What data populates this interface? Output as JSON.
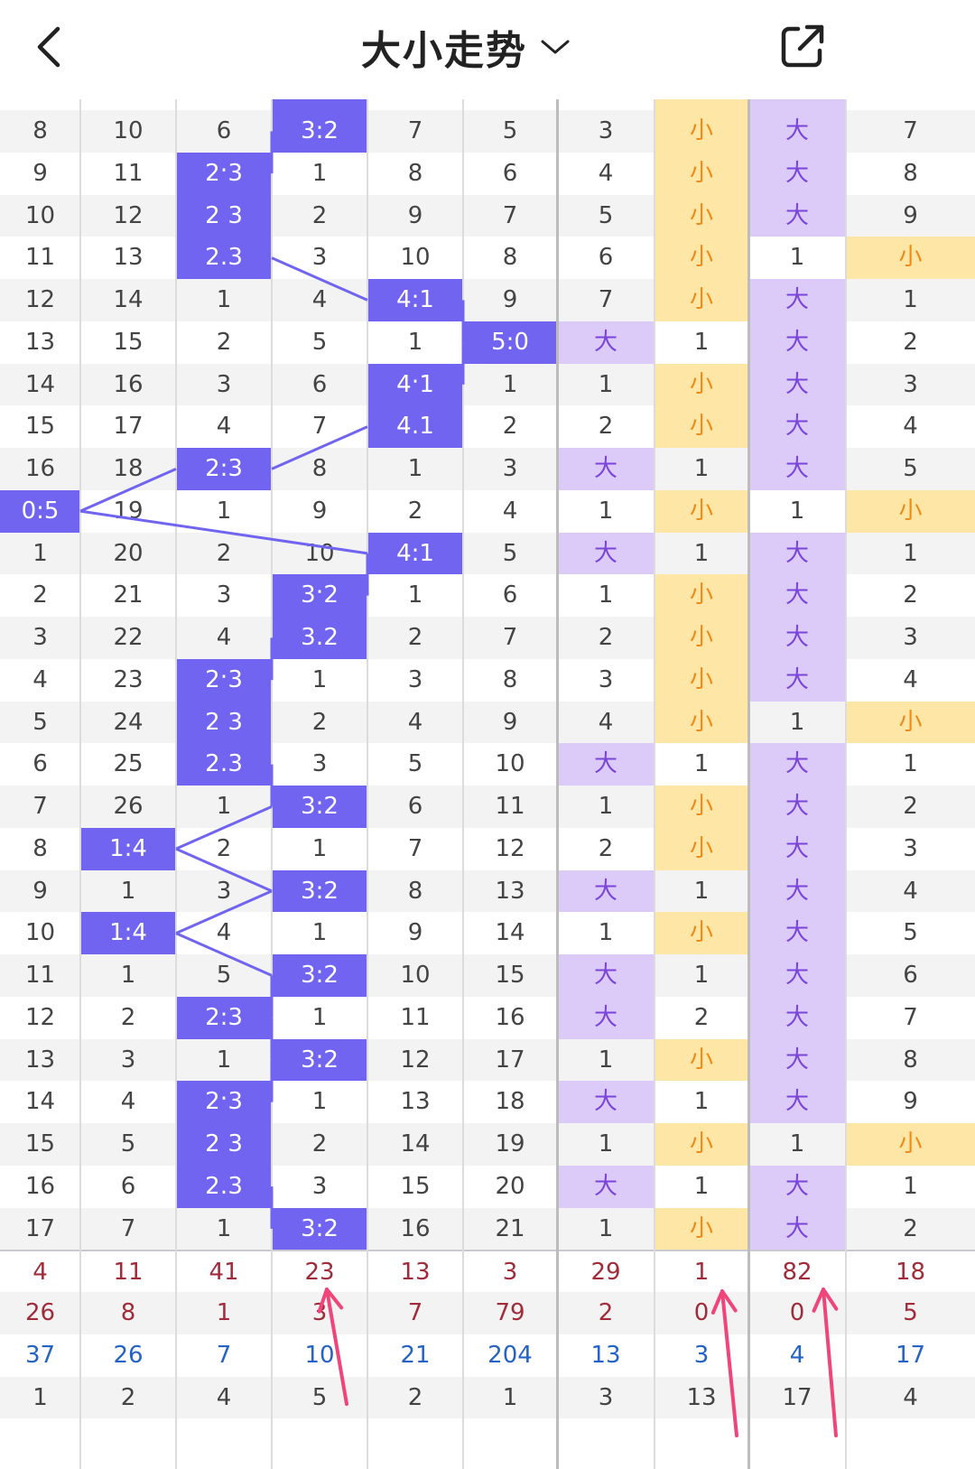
{
  "header": {
    "title": "大小走势",
    "back_icon": "chevron-left-icon",
    "dropdown_icon": "chevron-down-icon",
    "share_icon": "share-external-icon"
  },
  "colors": {
    "highlight": "#7064f0",
    "big_bg": "#dccaf9",
    "big_text": "#7a45d8",
    "small_bg": "#fde6a6",
    "small_text": "#ee8a16",
    "stat_red": "#a02c3a",
    "stat_blue": "#2563c4",
    "annotation_arrow": "#f0457a"
  },
  "rows": [
    {
      "cells": [
        "8",
        "10",
        "6",
        "3:2",
        "7",
        "5",
        "3",
        "小",
        "大",
        "7"
      ]
    },
    {
      "cells": [
        "9",
        "11",
        "2:3",
        "1",
        "8",
        "6",
        "4",
        "小",
        "大",
        "8"
      ]
    },
    {
      "cells": [
        "10",
        "12",
        "2:3",
        "2",
        "9",
        "7",
        "5",
        "小",
        "大",
        "9"
      ]
    },
    {
      "cells": [
        "11",
        "13",
        "2:3",
        "3",
        "10",
        "8",
        "6",
        "小",
        "1",
        "小"
      ]
    },
    {
      "cells": [
        "12",
        "14",
        "1",
        "4",
        "4:1",
        "9",
        "7",
        "小",
        "大",
        "1"
      ]
    },
    {
      "cells": [
        "13",
        "15",
        "2",
        "5",
        "1",
        "5:0",
        "大",
        "1",
        "大",
        "2"
      ]
    },
    {
      "cells": [
        "14",
        "16",
        "3",
        "6",
        "4:1",
        "1",
        "1",
        "小",
        "大",
        "3"
      ]
    },
    {
      "cells": [
        "15",
        "17",
        "4",
        "7",
        "4:1",
        "2",
        "2",
        "小",
        "大",
        "4"
      ]
    },
    {
      "cells": [
        "16",
        "18",
        "2:3",
        "8",
        "1",
        "3",
        "大",
        "1",
        "大",
        "5"
      ]
    },
    {
      "cells": [
        "0:5",
        "19",
        "1",
        "9",
        "2",
        "4",
        "1",
        "小",
        "1",
        "小"
      ]
    },
    {
      "cells": [
        "1",
        "20",
        "2",
        "10",
        "4:1",
        "5",
        "大",
        "1",
        "大",
        "1"
      ]
    },
    {
      "cells": [
        "2",
        "21",
        "3",
        "3:2",
        "1",
        "6",
        "1",
        "小",
        "大",
        "2"
      ]
    },
    {
      "cells": [
        "3",
        "22",
        "4",
        "3:2",
        "2",
        "7",
        "2",
        "小",
        "大",
        "3"
      ]
    },
    {
      "cells": [
        "4",
        "23",
        "2:3",
        "1",
        "3",
        "8",
        "3",
        "小",
        "大",
        "4"
      ]
    },
    {
      "cells": [
        "5",
        "24",
        "2:3",
        "2",
        "4",
        "9",
        "4",
        "小",
        "1",
        "小"
      ]
    },
    {
      "cells": [
        "6",
        "25",
        "2:3",
        "3",
        "5",
        "10",
        "大",
        "1",
        "大",
        "1"
      ]
    },
    {
      "cells": [
        "7",
        "26",
        "1",
        "3:2",
        "6",
        "11",
        "1",
        "小",
        "大",
        "2"
      ]
    },
    {
      "cells": [
        "8",
        "1:4",
        "2",
        "1",
        "7",
        "12",
        "2",
        "小",
        "大",
        "3"
      ]
    },
    {
      "cells": [
        "9",
        "1",
        "3",
        "3:2",
        "8",
        "13",
        "大",
        "1",
        "大",
        "4"
      ]
    },
    {
      "cells": [
        "10",
        "1:4",
        "4",
        "1",
        "9",
        "14",
        "1",
        "小",
        "大",
        "5"
      ]
    },
    {
      "cells": [
        "11",
        "1",
        "5",
        "3:2",
        "10",
        "15",
        "大",
        "1",
        "大",
        "6"
      ]
    },
    {
      "cells": [
        "12",
        "2",
        "2:3",
        "1",
        "11",
        "16",
        "大",
        "2",
        "大",
        "7"
      ]
    },
    {
      "cells": [
        "13",
        "3",
        "1",
        "3:2",
        "12",
        "17",
        "1",
        "小",
        "大",
        "8"
      ]
    },
    {
      "cells": [
        "14",
        "4",
        "2:3",
        "1",
        "13",
        "18",
        "大",
        "1",
        "大",
        "9"
      ]
    },
    {
      "cells": [
        "15",
        "5",
        "2:3",
        "2",
        "14",
        "19",
        "1",
        "小",
        "1",
        "小"
      ]
    },
    {
      "cells": [
        "16",
        "6",
        "2:3",
        "3",
        "15",
        "20",
        "大",
        "1",
        "大",
        "1"
      ]
    },
    {
      "cells": [
        "17",
        "7",
        "1",
        "3:2",
        "16",
        "21",
        "1",
        "小",
        "大",
        "2"
      ]
    }
  ],
  "stats": [
    {
      "cells": [
        "4",
        "11",
        "41",
        "23",
        "13",
        "3",
        "29",
        "1",
        "82",
        "18"
      ]
    },
    {
      "cells": [
        "26",
        "8",
        "1",
        "3",
        "7",
        "79",
        "2",
        "0",
        "0",
        "5"
      ]
    },
    {
      "cells": [
        "37",
        "26",
        "7",
        "10",
        "21",
        "204",
        "13",
        "3",
        "4",
        "17"
      ]
    },
    {
      "cells": [
        "1",
        "2",
        "4",
        "5",
        "2",
        "1",
        "3",
        "13",
        "17",
        "4"
      ]
    }
  ]
}
